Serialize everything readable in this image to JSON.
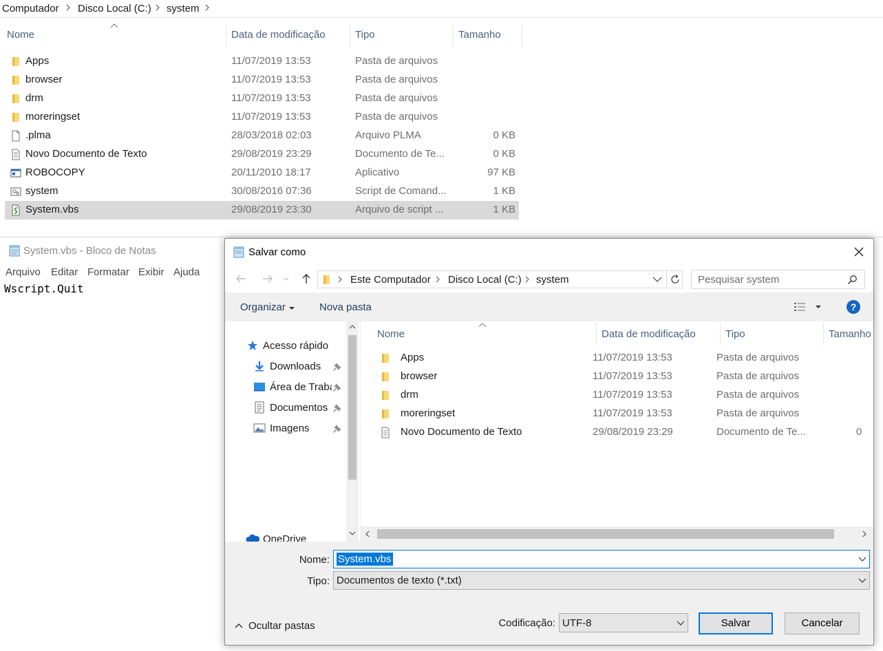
{
  "explorer": {
    "breadcrumb": [
      "Computador",
      "Disco Local (C:)",
      "system"
    ],
    "columns": {
      "name": "Nome",
      "date": "Data de modificação",
      "type": "Tipo",
      "size": "Tamanho"
    },
    "rows": [
      {
        "name": "Apps",
        "date": "11/07/2019 13:53",
        "type": "Pasta de arquivos",
        "size": "",
        "icon": "folder-icon"
      },
      {
        "name": "browser",
        "date": "11/07/2019 13:53",
        "type": "Pasta de arquivos",
        "size": "",
        "icon": "folder-icon"
      },
      {
        "name": "drm",
        "date": "11/07/2019 13:53",
        "type": "Pasta de arquivos",
        "size": "",
        "icon": "folder-icon"
      },
      {
        "name": "moreringset",
        "date": "11/07/2019 13:53",
        "type": "Pasta de arquivos",
        "size": "",
        "icon": "folder-icon"
      },
      {
        "name": ".plma",
        "date": "28/03/2018 02:03",
        "type": "Arquivo PLMA",
        "size": "0 KB",
        "icon": "file-icon"
      },
      {
        "name": "Novo Documento de Texto",
        "date": "29/08/2019 23:29",
        "type": "Documento de Te...",
        "size": "0 KB",
        "icon": "text-file-icon"
      },
      {
        "name": "ROBOCOPY",
        "date": "20/11/2010 18:17",
        "type": "Aplicativo",
        "size": "97 KB",
        "icon": "application-icon"
      },
      {
        "name": "system",
        "date": "30/08/2016 07:36",
        "type": "Script de Comand...",
        "size": "1 KB",
        "icon": "batch-script-icon"
      },
      {
        "name": "System.vbs",
        "date": "29/08/2019 23:30",
        "type": "Arquivo de script ...",
        "size": "1 KB",
        "icon": "vbscript-icon",
        "selected": true
      }
    ]
  },
  "notepad": {
    "title": "System.vbs - Bloco de Notas",
    "menu": [
      "Arquivo",
      "Editar",
      "Formatar",
      "Exibir",
      "Ajuda"
    ],
    "content": "Wscript.Quit"
  },
  "dialog": {
    "title": "Salvar como",
    "address": [
      "Este Computador",
      "Disco Local (C:)",
      "system"
    ],
    "search_placeholder": "Pesquisar system",
    "toolbar": {
      "organize": "Organizar",
      "new_folder": "Nova pasta"
    },
    "nav_tree": [
      {
        "label": "Acesso rápido",
        "icon": "star-icon"
      },
      {
        "label": "Downloads",
        "icon": "download-icon",
        "pinned": true
      },
      {
        "label": "Área de Traba",
        "icon": "desktop-icon",
        "pinned": true
      },
      {
        "label": "Documentos",
        "icon": "documents-icon",
        "pinned": true
      },
      {
        "label": "Imagens",
        "icon": "pictures-icon",
        "pinned": true
      },
      {
        "label": "OneDrive",
        "icon": "onedrive-icon"
      }
    ],
    "columns": {
      "name": "Nome",
      "date": "Data de modificação",
      "type": "Tipo",
      "size": "Tamanho"
    },
    "rows": [
      {
        "name": "Apps",
        "date": "11/07/2019 13:53",
        "type": "Pasta de arquivos",
        "size": "",
        "icon": "folder-icon"
      },
      {
        "name": "browser",
        "date": "11/07/2019 13:53",
        "type": "Pasta de arquivos",
        "size": "",
        "icon": "folder-icon"
      },
      {
        "name": "drm",
        "date": "11/07/2019 13:53",
        "type": "Pasta de arquivos",
        "size": "",
        "icon": "folder-icon"
      },
      {
        "name": "moreringset",
        "date": "11/07/2019 13:53",
        "type": "Pasta de arquivos",
        "size": "",
        "icon": "folder-icon"
      },
      {
        "name": "Novo Documento de Texto",
        "date": "29/08/2019 23:29",
        "type": "Documento de Te...",
        "size": "0",
        "icon": "text-file-icon"
      }
    ],
    "form": {
      "name_label": "Nome:",
      "name_value": "System.vbs",
      "type_label": "Tipo:",
      "type_value": "Documentos de texto (*.txt)",
      "encoding_label": "Codificação:",
      "encoding_value": "UTF-8",
      "hide_folders": "Ocultar pastas",
      "save": "Salvar",
      "cancel": "Cancelar"
    }
  },
  "colors": {
    "accent": "#0078d7",
    "folder": "#f8d775",
    "selection": "#d9d9d9",
    "header_text": "#4c607a"
  }
}
